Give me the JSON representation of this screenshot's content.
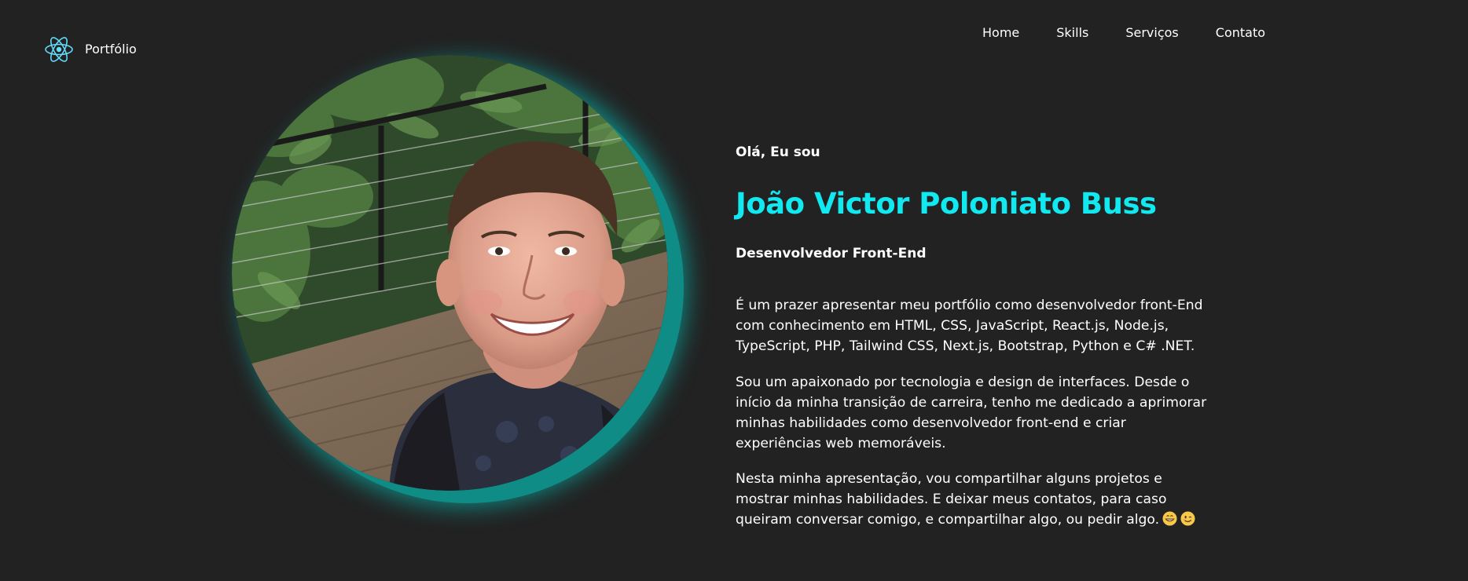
{
  "header": {
    "brand_label": "Portfólio",
    "nav": [
      {
        "label": "Home"
      },
      {
        "label": "Skills"
      },
      {
        "label": "Serviços"
      },
      {
        "label": "Contato"
      }
    ]
  },
  "hero": {
    "greeting": "Olá, Eu sou",
    "name": "João Victor Poloniato Buss",
    "role": "Desenvolvedor Front-End",
    "paragraphs": [
      "É um prazer apresentar meu portfólio como desenvolvedor front-End com conhecimento em HTML, CSS, JavaScript, React.js, Node.js, TypeScript, PHP, Tailwind CSS, Next.js, Bootstrap, Python e C# .NET.",
      "Sou um apaixonado por tecnologia e design de interfaces. Desde o início da minha transição de carreira, tenho me dedicado a aprimorar minhas habilidades como desenvolvedor front-end e criar experiências web memoráveis.",
      "Nesta minha apresentação, vou compartilhar alguns projetos e mostrar minhas habilidades. E deixar meus contatos, para caso queiram conversar comigo, e compartilhar algo, ou pedir algo."
    ]
  },
  "icons": {
    "brand": "react-atom-icon",
    "emoji_1": "grinning-face-emoji",
    "emoji_2": "winking-face-emoji"
  },
  "colors": {
    "background": "#222222",
    "accent": "#11e8f0",
    "glow": "#0f8c86",
    "react_logo": "#61dafb"
  }
}
